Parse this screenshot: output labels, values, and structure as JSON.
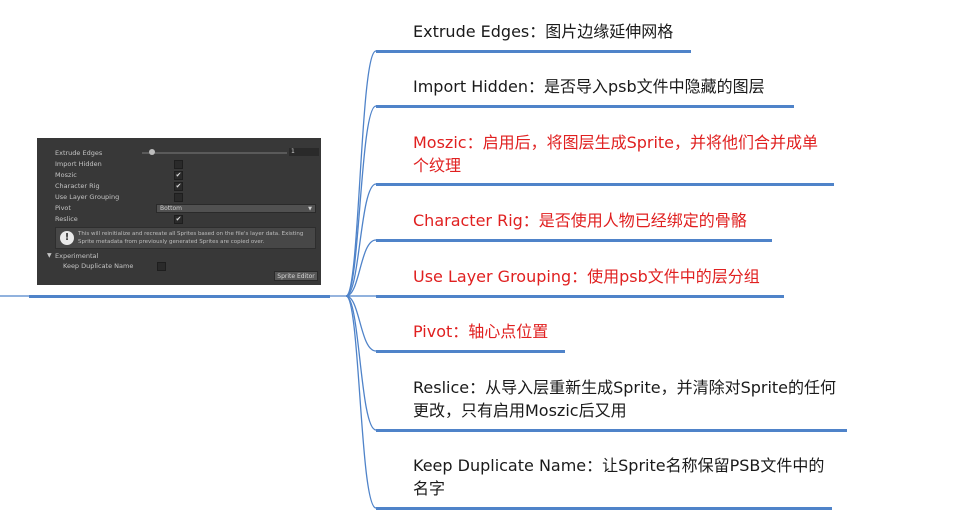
{
  "colors": {
    "connector": "#4f83c9",
    "text_default": "#1a1a1a",
    "text_highlight": "#e02020"
  },
  "inspector": {
    "fields": [
      {
        "label": "Extrude Edges",
        "control": "slider",
        "value": "1",
        "slider_fraction": 0.05
      },
      {
        "label": "Import Hidden",
        "control": "checkbox",
        "checked": false
      },
      {
        "label": "Moszic",
        "control": "checkbox",
        "checked": true
      },
      {
        "label": "Character Rig",
        "control": "checkbox",
        "checked": true
      },
      {
        "label": "Use Layer Grouping",
        "control": "checkbox",
        "checked": false
      },
      {
        "label": "Pivot",
        "control": "select",
        "value": "Bottom"
      },
      {
        "label": "Reslice",
        "control": "checkbox",
        "checked": true
      }
    ],
    "info_message": "This will reinitialize and recreate all Sprites based on the file's layer data. Existing Sprite metadata from previously generated Sprites are copied over.",
    "experimental_label": "Experimental",
    "keep_duplicate_label": "Keep Duplicate Name",
    "keep_duplicate_checked": false,
    "sprite_editor_label": "Sprite Editor",
    "check_glyph": "✔"
  },
  "nodes": [
    {
      "text": "Extrude Edges：图片边缘延伸网格",
      "highlight": false
    },
    {
      "text": "Import Hidden：是否导入psb文件中隐藏的图层",
      "highlight": false
    },
    {
      "text": "Moszic：启用后，将图层生成Sprite，并将他们合并成单个纹理",
      "highlight": true
    },
    {
      "text": "Character Rig：是否使用人物已经绑定的骨骼",
      "highlight": true
    },
    {
      "text": "Use Layer Grouping：使用psb文件中的层分组",
      "highlight": true
    },
    {
      "text": "Pivot：轴心点位置",
      "highlight": true
    },
    {
      "text": "Reslice：从导入层重新生成Sprite，并清除对Sprite的任何更改，只有启用Moszic后又用",
      "highlight": false
    },
    {
      "text": "Keep Duplicate Name：让Sprite名称保留PSB文件中的名字",
      "highlight": false
    }
  ]
}
